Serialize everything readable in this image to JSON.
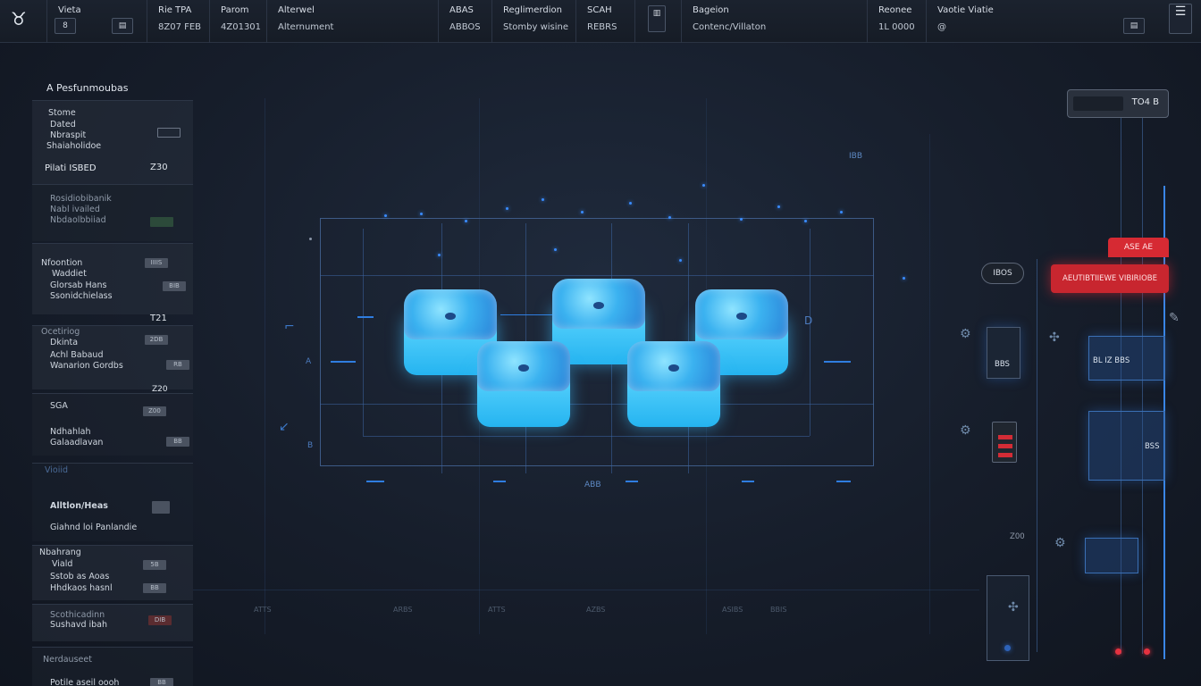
{
  "app_icon": "app-logo-icon",
  "topbar": {
    "columns": [
      {
        "label": "Vieta",
        "value": "8"
      },
      {
        "label": "Rie TPA",
        "value": "8Z07 FEB"
      },
      {
        "label": "Parom",
        "value": "4Z01301"
      },
      {
        "label": "Alterwel",
        "value": "Alternument"
      },
      {
        "label": "ABAS",
        "value": "ABBOS"
      },
      {
        "label": "Reglimerdion",
        "value": "Stomby wisine"
      },
      {
        "label": "SCAH",
        "value": "REBRS"
      },
      {
        "label": "",
        "value": ""
      },
      {
        "label": "Bageion",
        "value": "Contenc/Villaton"
      },
      {
        "label": "Reonee",
        "value": "1L 0000"
      },
      {
        "label": "Vaotie  Viatie",
        "value": "@"
      }
    ],
    "mini_box_label": "□",
    "mini_box_right_label": "□",
    "mini_box_glyph": "▤",
    "right_button_glyph": "☰"
  },
  "sidebar": {
    "title": "A Pesfunmoubas",
    "blocks": [
      {
        "lines": [
          "Stome",
          "Dated",
          "Nbraspit",
          "Shaiaholidoe"
        ],
        "metric_label": "Pilati ISBED",
        "metric_value": "Z30"
      },
      {
        "lines": [
          "Rosidiobibanik",
          "Nabl ivailed",
          "Nbdaolbbiiad"
        ],
        "metric_label": "",
        "metric_value": ""
      },
      {
        "lines": [
          "Nfoontion",
          "Waddiet",
          "Glorsab Hans",
          "Ssonidchielass"
        ],
        "metric_label": "",
        "metric_value": "T21"
      },
      {
        "lines": [
          "Ocetiriog",
          "Dkinta",
          "Achl Babaud",
          "Wanarion Gordbs"
        ],
        "metric_label": "",
        "metric_value": "Z20"
      },
      {
        "lines": [
          "SGA",
          "Ndhahlah",
          "Galaadlavan"
        ],
        "metric_label": "",
        "metric_value": ""
      },
      {
        "lines": [
          "Vioiid",
          "Alltlon/Heas",
          "Giahnd loi Panlandie"
        ],
        "metric_label": "",
        "metric_value": ""
      },
      {
        "lines": [
          "Nbahrang",
          "Viald",
          "Sstob as Aoas",
          "Hhdkaos hasnl"
        ],
        "metric_label": "",
        "metric_value": ""
      },
      {
        "lines": [
          "Scothicadinn",
          "Sushavd ibah"
        ],
        "metric_label": "",
        "metric_value": ""
      },
      {
        "lines": [
          "Nerdauseet",
          "Potile aseil oooh"
        ],
        "metric_label": "",
        "metric_value": ""
      }
    ],
    "chips": [
      "IIIIS",
      "BIB",
      "2DB",
      "RB",
      "Z00",
      "BB",
      "5B",
      "BB",
      "DIB",
      "BB"
    ]
  },
  "stage": {
    "top_label": "IBB",
    "bottom_label": "ABB",
    "axis_labels": [
      "A",
      "B",
      "D"
    ],
    "bottom_ticks": [
      "ATTS",
      "ARBS",
      "ATTS",
      "AZBS",
      "ASIBS",
      "BBIS"
    ]
  },
  "right_panel": {
    "search_value": "TO4  B",
    "pill_label": "IBOS",
    "alert_top_label": "ASE  AE",
    "alert_main_label": "AEUTIBTIIEWE  VIBIRIOBE",
    "card_labels": [
      "BBS",
      "BL  IZ  BBS",
      "BSS"
    ],
    "misc_label": "Z00"
  },
  "colors": {
    "accent": "#2f7de0",
    "glow": "#4cc6ff",
    "alert": "#d62a33"
  }
}
